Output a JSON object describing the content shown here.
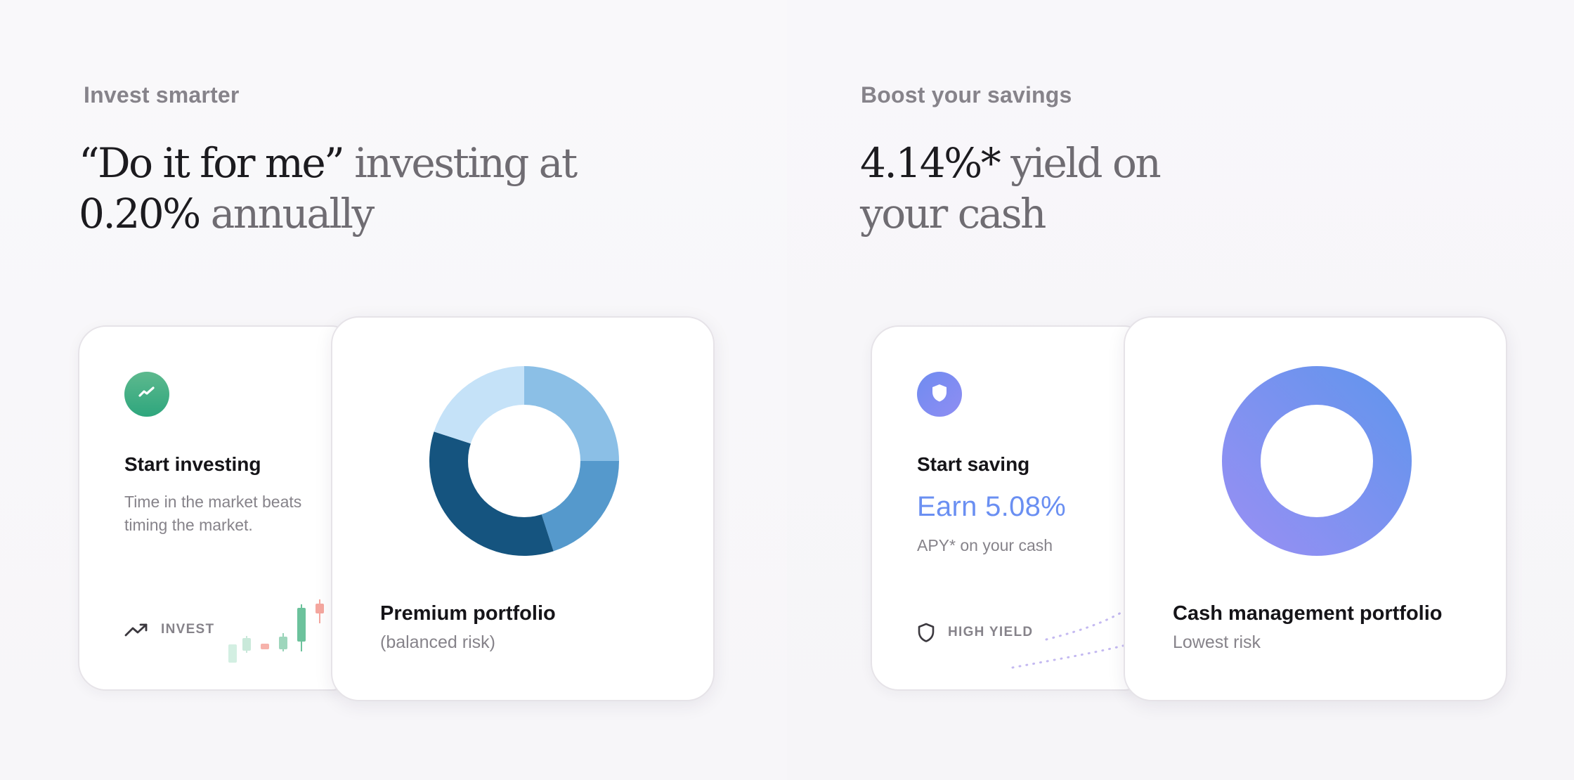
{
  "left": {
    "eyebrow": "Invest smarter",
    "headline": {
      "part1": "“Do it for me”",
      "part2": " investing at",
      "part3": "0.20%",
      "part4": " annually"
    },
    "back_card": {
      "title": "Start investing",
      "description": "Time in the market beats timing the market.",
      "tag": "INVEST",
      "icon": "chart-trend-icon",
      "accent": "#2ea67d"
    },
    "front_card": {
      "title": "Premium portfolio",
      "subtitle": "(balanced risk)"
    }
  },
  "right": {
    "eyebrow": "Boost your savings",
    "headline": {
      "part1": "4.14%*",
      "part2": " yield on",
      "part3": "your cash"
    },
    "back_card": {
      "title": "Start saving",
      "earn": "Earn 5.08%",
      "apy_note": "APY* on your cash",
      "tag": "HIGH YIELD",
      "icon": "shield-icon",
      "accent": "#6a8ff2"
    },
    "front_card": {
      "title": "Cash management portfolio",
      "subtitle": "Lowest risk"
    }
  },
  "chart_data": [
    {
      "type": "pie",
      "variant": "donut",
      "title": "Premium portfolio",
      "values": [
        25,
        20,
        35,
        20
      ],
      "colors": [
        "#8bbfe6",
        "#5599cc",
        "#15547f",
        "#c5e2f8"
      ]
    },
    {
      "type": "pie",
      "variant": "donut",
      "title": "Cash management portfolio",
      "values": [
        100
      ],
      "colors": [
        "#7a96ef"
      ]
    }
  ]
}
